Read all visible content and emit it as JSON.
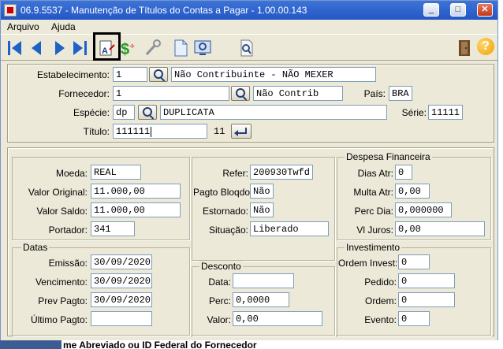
{
  "window": {
    "title": "06.9.5537 - Manutenção de Títulos do Contas a Pagar - 1.00.00.143",
    "controls": {
      "minimize": "_",
      "maximize": "□",
      "close": "✕"
    }
  },
  "menu": {
    "items": [
      "Arquivo",
      "Ajuda"
    ]
  },
  "toolbar": {
    "icons": [
      "first-record-icon",
      "previous-record-icon",
      "next-record-icon",
      "last-record-icon",
      "edit-document-icon",
      "money-icon",
      "wrench-icon",
      "new-document-icon",
      "view-screen-icon",
      "search-document-icon",
      "exit-door-icon",
      "help-icon"
    ],
    "help_label": "?"
  },
  "header": {
    "estabelecimento": {
      "label": "Estabelecimento:",
      "value": "1",
      "desc": "Não Contribuinte - NÃO MEXER"
    },
    "fornecedor": {
      "label": "Fornecedor:",
      "value": "1",
      "desc": "Não Contrib"
    },
    "pais": {
      "label": "País:",
      "value": "BRA"
    },
    "especie": {
      "label": "Espécie:",
      "value": "dp",
      "desc": "DUPLICATA"
    },
    "serie": {
      "label": "Série:",
      "value": "11111"
    },
    "titulo": {
      "label": "Título:",
      "value": "111111",
      "parcela": "11"
    }
  },
  "valores": {
    "moeda": {
      "label": "Moeda:",
      "value": "REAL"
    },
    "valor_original": {
      "label": "Valor Original:",
      "value": "11.000,00"
    },
    "valor_saldo": {
      "label": "Valor Saldo:",
      "value": "11.000,00"
    },
    "portador": {
      "label": "Portador:",
      "value": "341"
    }
  },
  "datas": {
    "title": "Datas",
    "emissao": {
      "label": "Emissão:",
      "value": "30/09/2020"
    },
    "vencimento": {
      "label": "Vencimento:",
      "value": "30/09/2020"
    },
    "prev_pagto": {
      "label": "Prev Pagto:",
      "value": "30/09/2020"
    },
    "ultimo_pagto": {
      "label": "Último Pagto:",
      "value": ""
    }
  },
  "situacao_box": {
    "refer": {
      "label": "Refer:",
      "value": "200930Twfd"
    },
    "pagto_bloqdo": {
      "label": "Pagto Bloqdo:",
      "value": "Não"
    },
    "estornado": {
      "label": "Estornado:",
      "value": "Não"
    },
    "situacao": {
      "label": "Situação:",
      "value": "Liberado"
    }
  },
  "desconto": {
    "title": "Desconto",
    "data": {
      "label": "Data:",
      "value": ""
    },
    "perc": {
      "label": "Perc:",
      "value": "0,0000"
    },
    "valor": {
      "label": "Valor:",
      "value": "0,00"
    }
  },
  "despesa": {
    "title": "Despesa Financeira",
    "dias_atr": {
      "label": "Dias Atr:",
      "value": "0"
    },
    "multa_atr": {
      "label": "Multa Atr:",
      "value": "0,00"
    },
    "perc_dia": {
      "label": "Perc Dia:",
      "value": "0,000000"
    },
    "vl_juros": {
      "label": "Vl Juros:",
      "value": "0,00"
    }
  },
  "investimento": {
    "title": "Investimento",
    "ordem_invest": {
      "label": "Ordem Invest:",
      "value": "0"
    },
    "pedido": {
      "label": "Pedido:",
      "value": "0"
    },
    "ordem": {
      "label": "Ordem:",
      "value": "0"
    },
    "evento": {
      "label": "Evento:",
      "value": "0"
    }
  },
  "statusbar": {
    "text": "me Abreviado ou ID Federal do Fornecedor"
  }
}
